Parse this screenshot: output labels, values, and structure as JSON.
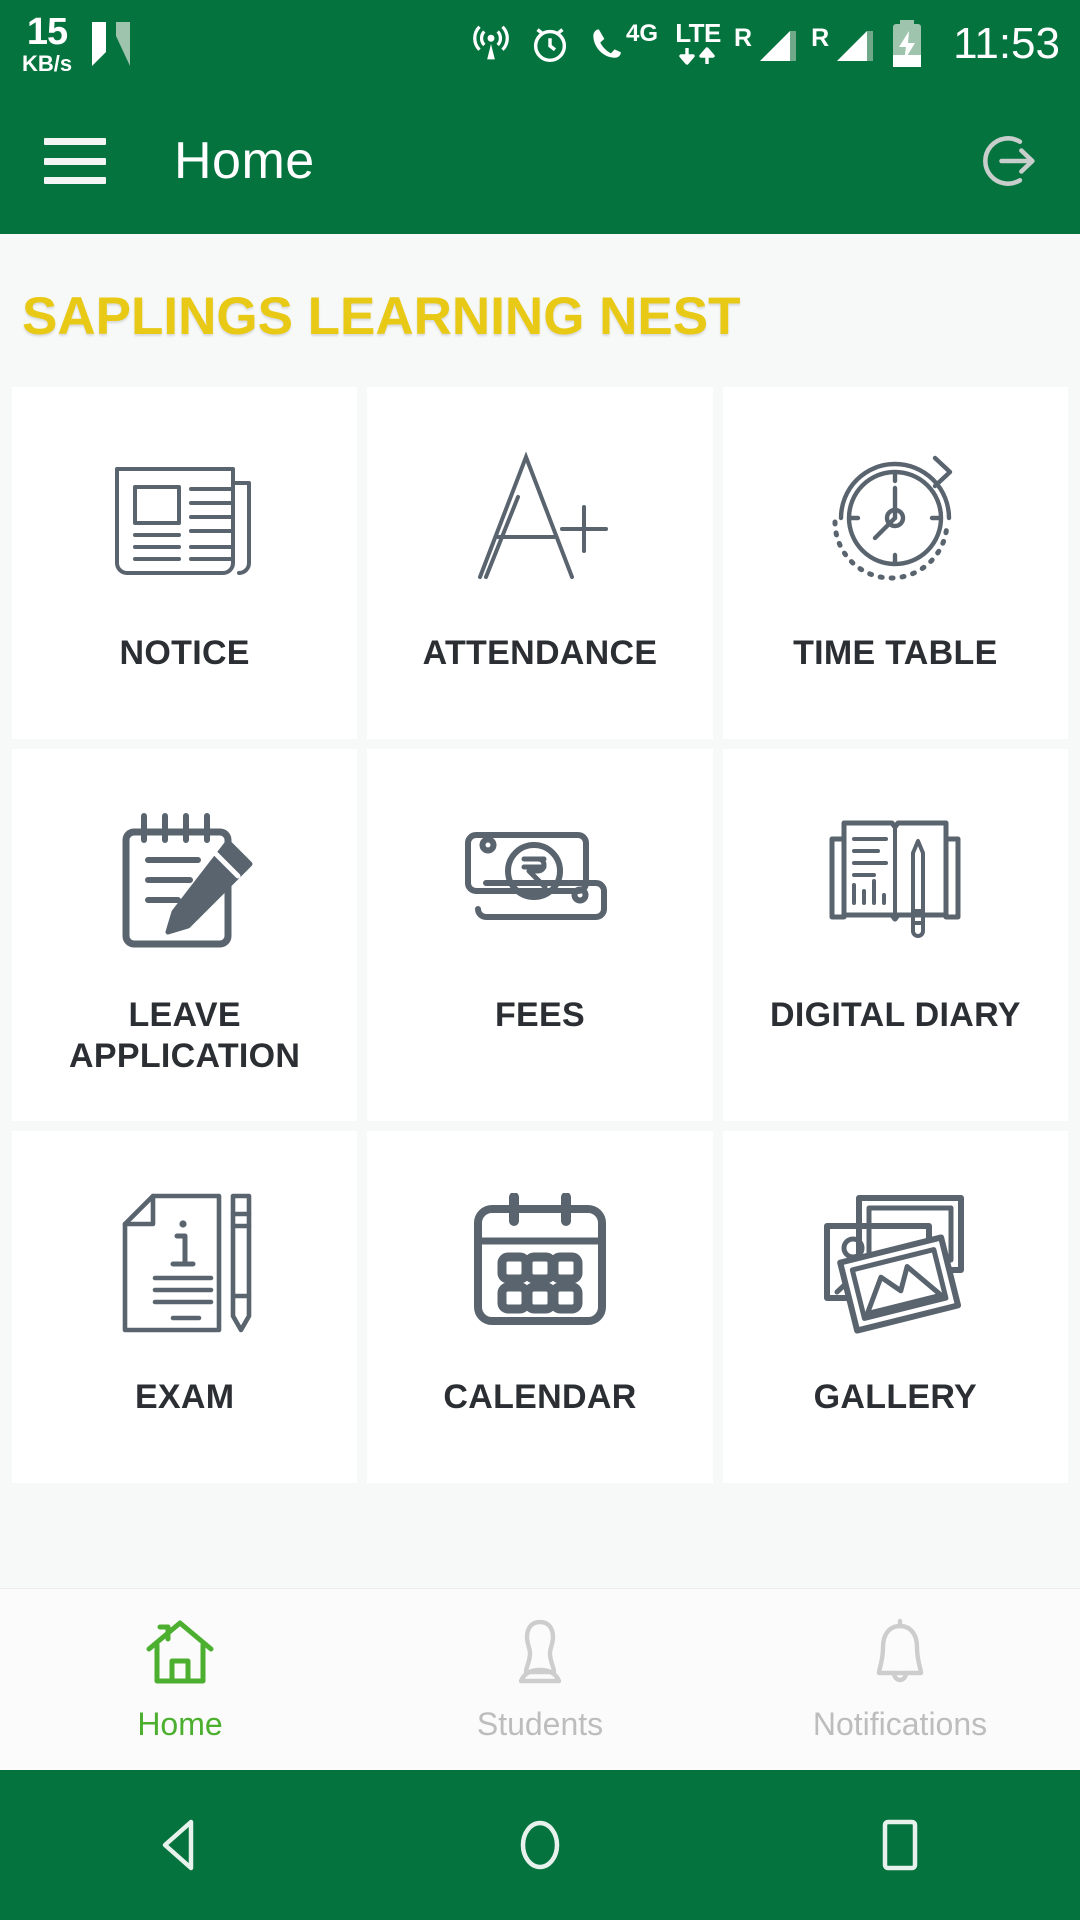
{
  "status_bar": {
    "network_speed_value": "15",
    "network_speed_unit": "KB/s",
    "app_badge_icon": "nova-launcher-icon",
    "icons": [
      "hotspot-icon",
      "alarm-icon",
      "call-4g-icon",
      "lte-data-icon",
      "signal-roaming-1-icon",
      "signal-roaming-2-icon",
      "battery-charging-icon"
    ],
    "mobile_network_4g": "4G",
    "mobile_network_lte": "LTE",
    "roaming_label_1": "R",
    "roaming_label_2": "R",
    "time": "11:53"
  },
  "app_bar": {
    "menu_icon": "hamburger-menu-icon",
    "title": "Home",
    "logout_icon": "logout-icon",
    "background_color": "#04733E"
  },
  "header": {
    "school_name": "SAPLINGS LEARNING NEST",
    "color": "#E8C916"
  },
  "grid": {
    "tiles": [
      {
        "label": "NOTICE",
        "icon": "newspaper-icon"
      },
      {
        "label": "ATTENDANCE",
        "icon": "grade-a-plus-icon"
      },
      {
        "label": "TIME TABLE",
        "icon": "clock-rotate-icon"
      },
      {
        "label": "LEAVE\nAPPLICATION",
        "icon": "notepad-pencil-icon"
      },
      {
        "label": "FEES",
        "icon": "rupee-banknotes-icon"
      },
      {
        "label": "DIGITAL DIARY",
        "icon": "open-book-pencil-icon"
      },
      {
        "label": "EXAM",
        "icon": "document-pen-icon"
      },
      {
        "label": "CALENDAR",
        "icon": "calendar-icon"
      },
      {
        "label": "GALLERY",
        "icon": "photos-stack-icon"
      }
    ],
    "tile_background": "#FFFFFF",
    "icon_color": "#5A646E",
    "label_color": "#2B2F33"
  },
  "bottom_nav": {
    "items": [
      {
        "label": "Home",
        "icon": "home-icon",
        "active": true
      },
      {
        "label": "Students",
        "icon": "person-icon",
        "active": false
      },
      {
        "label": "Notifications",
        "icon": "bell-icon",
        "active": false
      }
    ],
    "active_color": "#4CAF2F",
    "inactive_color": "#BDBDBD"
  },
  "android_nav": {
    "back_icon": "back-triangle-icon",
    "home_icon": "home-circle-icon",
    "recents_icon": "recents-square-icon",
    "background_color": "#04733E"
  }
}
